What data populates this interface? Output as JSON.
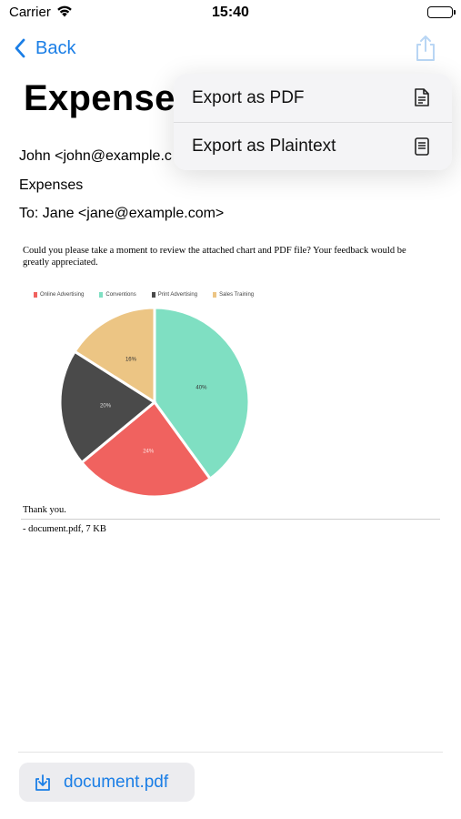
{
  "status_bar": {
    "carrier": "Carrier",
    "time": "15:40",
    "battery_level": 1.0
  },
  "nav": {
    "back_label": "Back"
  },
  "header": {
    "title": "Expense",
    "from": "John <john@example.c",
    "subject": "Expenses",
    "to": "To: Jane <jane@example.com>"
  },
  "body": {
    "message": "Could you please take a moment to review the attached chart and PDF file? Your feedback would be greatly appreciated.",
    "closing": "Thank you.",
    "attachment_line": "- document.pdf, 7 KB"
  },
  "chart_data": {
    "type": "pie",
    "categories": [
      "Online Advertising",
      "Conventions",
      "Print Advertising",
      "Sales Training"
    ],
    "values": [
      24,
      40,
      20,
      16
    ],
    "labels": [
      "24%",
      "40%",
      "20%",
      "16%"
    ],
    "colors": [
      "#f0625f",
      "#7fdfc2",
      "#4a4a4a",
      "#ecc584"
    ],
    "legend_position": "top"
  },
  "attachment_button": {
    "label": "document.pdf"
  },
  "menu": {
    "items": [
      {
        "label": "Export as PDF",
        "icon": "pdf-document-icon"
      },
      {
        "label": "Export as Plaintext",
        "icon": "plaintext-document-icon"
      }
    ]
  },
  "colors": {
    "accent": "#1a7ee6"
  }
}
